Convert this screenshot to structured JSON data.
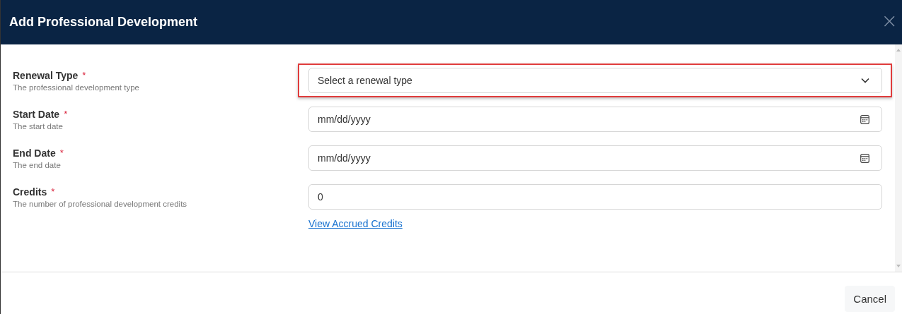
{
  "dialog": {
    "title": "Add Professional Development",
    "close_label": "×"
  },
  "fields": [
    {
      "label": "Renewal Type",
      "required_mark": "*",
      "description": "The professional development type",
      "kind": "select",
      "placeholder": "Select a renewal type",
      "highlighted": true
    },
    {
      "label": "Start Date",
      "required_mark": "*",
      "description": "The start date",
      "kind": "date",
      "placeholder": "mm/dd/yyyy",
      "highlighted": false
    },
    {
      "label": "End Date",
      "required_mark": "*",
      "description": "The end date",
      "kind": "date",
      "placeholder": "mm/dd/yyyy",
      "highlighted": false
    },
    {
      "label": "Credits",
      "required_mark": "*",
      "description": "The number of professional development credits",
      "kind": "number",
      "value": "0",
      "highlighted": false,
      "link": "View Accrued Credits"
    }
  ],
  "footer": {
    "buttons": [
      "Cancel"
    ]
  }
}
